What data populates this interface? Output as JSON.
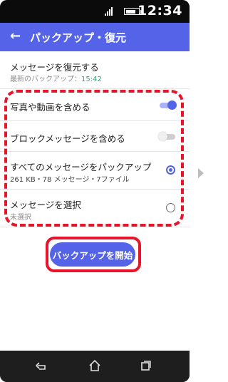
{
  "status_bar": {
    "time": "12:34",
    "icons": [
      "signal-icon",
      "battery-icon"
    ]
  },
  "app_bar": {
    "back_icon": "arrow-left-icon",
    "title": "パックアップ・復元"
  },
  "restore": {
    "title": "メッセージを復元する",
    "last_backup_label": "最新のバックアップ：",
    "last_backup_time": "15:42"
  },
  "options": [
    {
      "title": "写真や動画を含める",
      "control": "toggle",
      "checked": true
    },
    {
      "title": "ブロックメッセージを含める",
      "control": "toggle",
      "checked": false
    },
    {
      "title": "すべてのメッセージをパックアップ",
      "subtitle": "261 KB・78 メッセージ・7ファイル",
      "control": "radio",
      "checked": true
    },
    {
      "title": "メッセージを選択",
      "subtitle": "未選択",
      "control": "radio",
      "checked": false
    }
  ],
  "start_button": {
    "label": "バックアップを開始"
  },
  "nav_bar": {
    "icons": [
      "back-icon",
      "home-icon",
      "recent-apps-icon"
    ]
  },
  "colors": {
    "accent": "#5563e8",
    "highlight": "#e8142a",
    "time_green": "#2aa67d"
  }
}
